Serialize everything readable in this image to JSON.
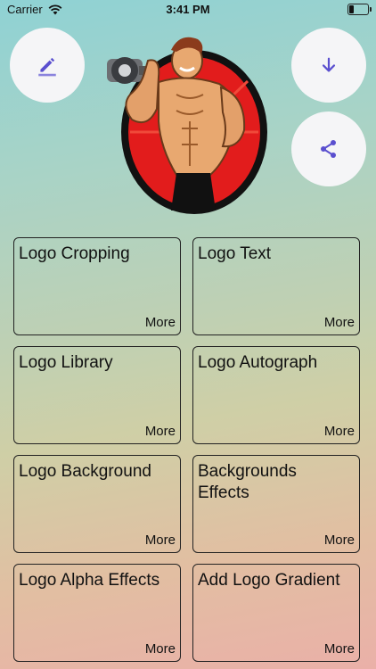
{
  "status": {
    "carrier": "Carrier",
    "time": "3:41 PM"
  },
  "icons": {
    "edit": "pencil-icon",
    "download": "arrow-down-icon",
    "share": "share-icon",
    "wifi": "wifi-icon",
    "battery": "battery-icon"
  },
  "colors": {
    "accent": "#5a4fcf",
    "card_border": "#222222",
    "button_bg": "#f5f5f7"
  },
  "cards": [
    {
      "title": "Logo Cropping",
      "more": "More"
    },
    {
      "title": "Logo Text",
      "more": "More"
    },
    {
      "title": "Logo Library",
      "more": "More"
    },
    {
      "title": "Logo Autograph",
      "more": "More"
    },
    {
      "title": "Logo Background",
      "more": "More"
    },
    {
      "title": "Backgrounds Effects",
      "more": "More"
    },
    {
      "title": "Logo Alpha Effects",
      "more": "More"
    },
    {
      "title": "Add Logo Gradient",
      "more": "More"
    }
  ]
}
